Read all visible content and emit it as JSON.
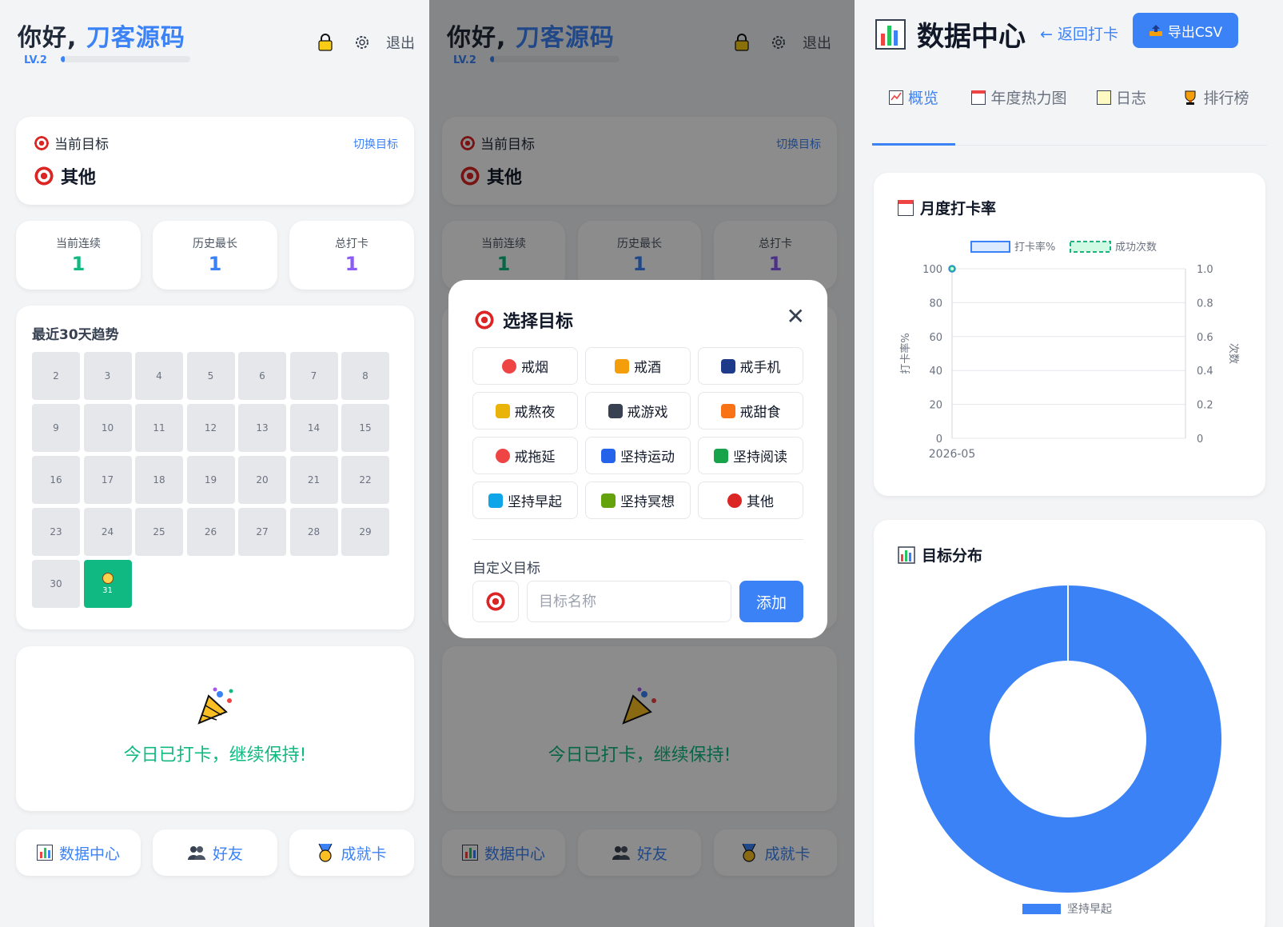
{
  "header": {
    "greeting": "你好,",
    "username": "刀客源码",
    "level": "LV.2",
    "level_progress": 0.03,
    "logout": "退出",
    "lock_icon": "lock-icon",
    "settings_icon": "gear-icon"
  },
  "goal": {
    "label": "当前目标",
    "switch": "切换目标",
    "name": "其他"
  },
  "stats": [
    {
      "label": "当前连续",
      "value": "1",
      "color": "#10b981"
    },
    {
      "label": "历史最长",
      "value": "1",
      "color": "#3b82f6"
    },
    {
      "label": "总打卡",
      "value": "1",
      "color": "#8b5cf6"
    }
  ],
  "trend": {
    "title": "最近30天趋势",
    "days": [
      "2",
      "3",
      "4",
      "5",
      "6",
      "7",
      "8",
      "9",
      "10",
      "11",
      "12",
      "13",
      "14",
      "15",
      "16",
      "17",
      "18",
      "19",
      "20",
      "21",
      "22",
      "23",
      "24",
      "25",
      "26",
      "27",
      "28",
      "29",
      "30",
      "31"
    ],
    "done_day": "31"
  },
  "checkin": {
    "message": "今日已打卡，继续保持!"
  },
  "nav": [
    {
      "label": "数据中心",
      "icon": "bar-chart-icon"
    },
    {
      "label": "好友",
      "icon": "users-icon"
    },
    {
      "label": "成就卡",
      "icon": "medal-icon"
    }
  ],
  "modal": {
    "title": "选择目标",
    "options": [
      {
        "label": "戒烟",
        "icon": "no-smoking-icon",
        "color": "#ef4444"
      },
      {
        "label": "戒酒",
        "icon": "beer-icon",
        "color": "#f59e0b"
      },
      {
        "label": "戒手机",
        "icon": "phone-icon",
        "color": "#1e3a8a"
      },
      {
        "label": "戒熬夜",
        "icon": "moon-icon",
        "color": "#eab308"
      },
      {
        "label": "戒游戏",
        "icon": "gamepad-icon",
        "color": "#374151"
      },
      {
        "label": "戒甜食",
        "icon": "cake-icon",
        "color": "#f97316"
      },
      {
        "label": "戒拖延",
        "icon": "alarm-clock-icon",
        "color": "#ef4444"
      },
      {
        "label": "坚持运动",
        "icon": "runner-icon",
        "color": "#2563eb"
      },
      {
        "label": "坚持阅读",
        "icon": "book-icon",
        "color": "#16a34a"
      },
      {
        "label": "坚持早起",
        "icon": "sunrise-icon",
        "color": "#0ea5e9"
      },
      {
        "label": "坚持冥想",
        "icon": "meditation-icon",
        "color": "#65a30d"
      },
      {
        "label": "其他",
        "icon": "target-icon",
        "color": "#dc2626"
      }
    ],
    "custom_label": "自定义目标",
    "name_placeholder": "目标名称",
    "add_label": "添加"
  },
  "data_center": {
    "title": "数据中心",
    "back": "← 返回打卡",
    "export": "导出CSV",
    "tabs": [
      {
        "label": "概览",
        "icon": "chart-check-icon",
        "active": true
      },
      {
        "label": "年度热力图",
        "icon": "calendar-icon",
        "active": false
      },
      {
        "label": "日志",
        "icon": "memo-icon",
        "active": false
      },
      {
        "label": "排行榜",
        "icon": "trophy-icon",
        "active": false
      }
    ],
    "monthly_title": "月度打卡率",
    "distribution_title": "目标分布"
  },
  "chart_data": [
    {
      "type": "line",
      "title": "月度打卡率",
      "x": [
        "2026-05"
      ],
      "series": [
        {
          "name": "打卡率%",
          "values": [
            100
          ],
          "axis": "left",
          "color": "#3b82f6",
          "style": "solid"
        },
        {
          "name": "成功次数",
          "values": [
            1
          ],
          "axis": "right",
          "color": "#10b981",
          "style": "dashed"
        }
      ],
      "ylabel": "打卡率%",
      "y2label": "次数",
      "ylim": [
        0,
        100
      ],
      "y2lim": [
        0,
        1.0
      ],
      "yticks": [
        "0",
        "20",
        "40",
        "60",
        "80",
        "100"
      ],
      "y2ticks": [
        "0",
        "0.2",
        "0.4",
        "0.6",
        "0.8",
        "1.0"
      ],
      "legend": "top"
    },
    {
      "type": "pie",
      "title": "目标分布",
      "categories": [
        "坚持早起"
      ],
      "values": [
        1
      ],
      "colors": [
        "#3b82f6"
      ],
      "donut": true,
      "legend": "bottom"
    }
  ]
}
